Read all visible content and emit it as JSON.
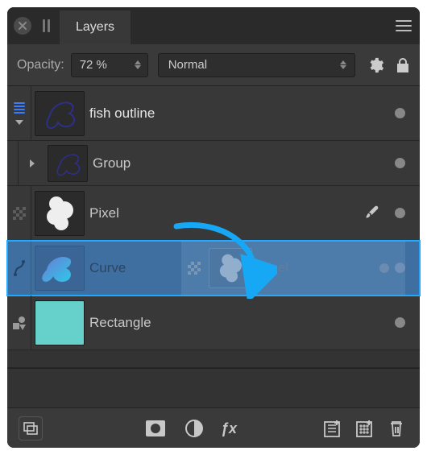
{
  "panel": {
    "tab_title": "Layers"
  },
  "options": {
    "opacity_label": "Opacity:",
    "opacity_value": "72 %",
    "blend_mode": "Normal"
  },
  "layers": [
    {
      "name": "fish outline",
      "type": "stack",
      "expanded": true,
      "has_dot": true
    },
    {
      "name": "Group",
      "type": "group",
      "expanded": false,
      "has_dot": true
    },
    {
      "name": "Pixel",
      "type": "pixel",
      "has_brush": true,
      "has_dot": true
    },
    {
      "name": "Curve",
      "type": "curve",
      "has_dot": true,
      "selected": true,
      "ghost": {
        "name": "Pixel"
      }
    },
    {
      "name": "Rectangle",
      "type": "shape",
      "has_dot": true
    }
  ],
  "icons": {
    "close": "close-icon",
    "pause": "pause-icon",
    "menu": "menu-icon",
    "gear": "gear-icon",
    "lock": "lock-icon",
    "mask": "mask-icon",
    "adjust": "adjustment-icon",
    "fx": "fx-icon",
    "add": "add-layer-icon",
    "add_mask": "add-mask-icon",
    "trash": "trash-icon",
    "merge": "merge-icon"
  }
}
